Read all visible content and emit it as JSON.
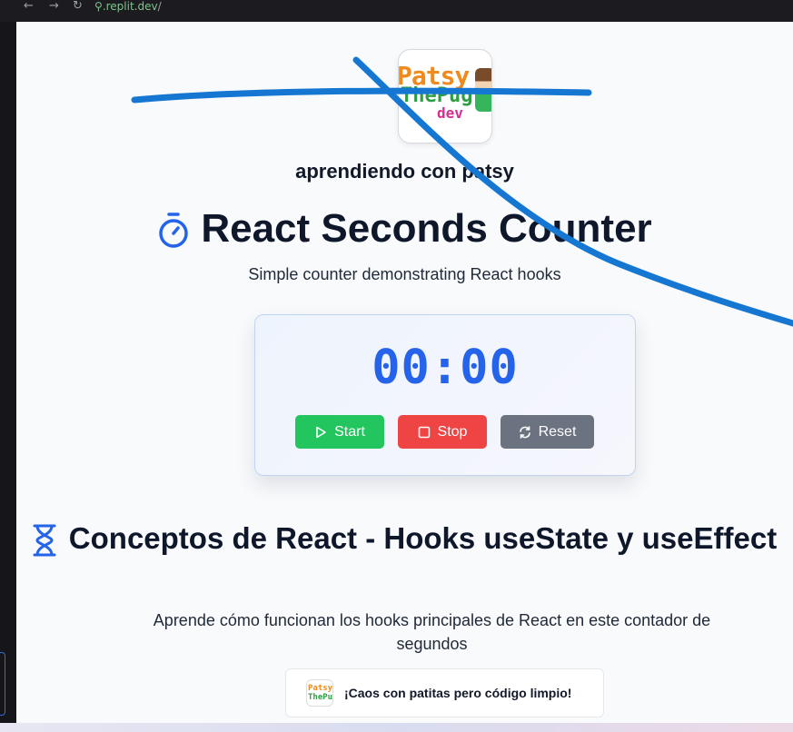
{
  "browser": {
    "back": "←",
    "forward": "→",
    "reload": "↻",
    "url_host": ".replit.dev",
    "url_path": "/"
  },
  "logo": {
    "line1": "Patsy",
    "line2": "ThePug",
    "line3": "dev"
  },
  "brand": "aprendiendo con patsy",
  "title": "React Seconds Counter",
  "subtitle": "Simple counter demonstrating React hooks",
  "timer": "00:00",
  "buttons": {
    "start": "Start",
    "stop": "Stop",
    "reset": "Reset"
  },
  "section": {
    "title": "Conceptos de React - Hooks useState y useEffect",
    "description": "Aprende cómo funcionan los hooks principales de React en este contador de segundos"
  },
  "badge": {
    "text": "¡Caos con patitas pero código limpio!"
  },
  "colors": {
    "accent": "#2563eb",
    "start": "#22c55e",
    "stop": "#ef4444",
    "reset": "#6b7280",
    "pen_stroke": "#1677d2"
  },
  "icons": {
    "title": "stopwatch-icon",
    "section": "hourglass-icon",
    "start": "play-icon",
    "stop": "square-icon",
    "reset": "refresh-icon",
    "url": "link-icon"
  }
}
